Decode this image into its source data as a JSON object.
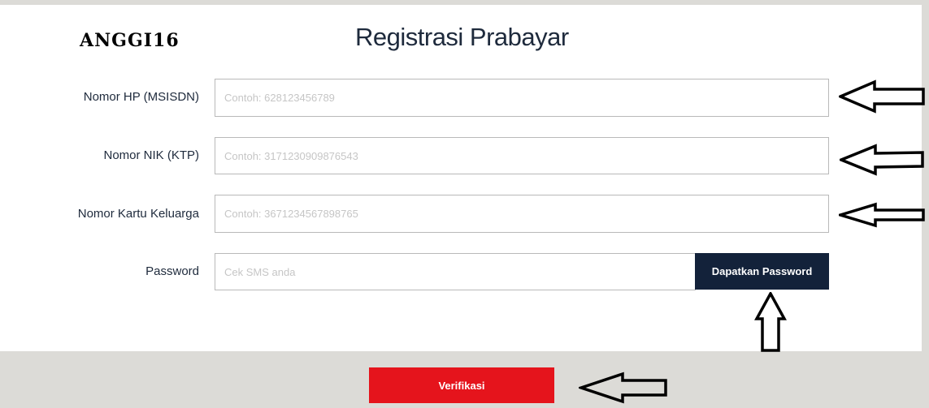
{
  "watermark": {
    "text": "ANGGI16"
  },
  "page": {
    "title": "Registrasi Prabayar"
  },
  "form": {
    "phone": {
      "label": "Nomor HP (MSISDN)",
      "placeholder": "Contoh: 628123456789",
      "value": ""
    },
    "nik": {
      "label": "Nomor NIK (KTP)",
      "placeholder": "Contoh: 3171230909876543",
      "value": ""
    },
    "kk": {
      "label": "Nomor Kartu Keluarga",
      "placeholder": "Contoh: 3671234567898765",
      "value": ""
    },
    "password": {
      "label": "Password",
      "placeholder": "Cek SMS anda",
      "value": ""
    },
    "get_password_label": "Dapatkan Password"
  },
  "footer": {
    "verify_label": "Verifikasi"
  },
  "annotations": {
    "arrow_icon": "hollow-arrow-icon",
    "arrows": [
      "left",
      "left",
      "left",
      "up",
      "left"
    ]
  },
  "colors": {
    "primary_dark": "#13223a",
    "accent_red": "#e5141c",
    "footer_bg": "#dcdbd7",
    "text": "#1e2a3c"
  }
}
